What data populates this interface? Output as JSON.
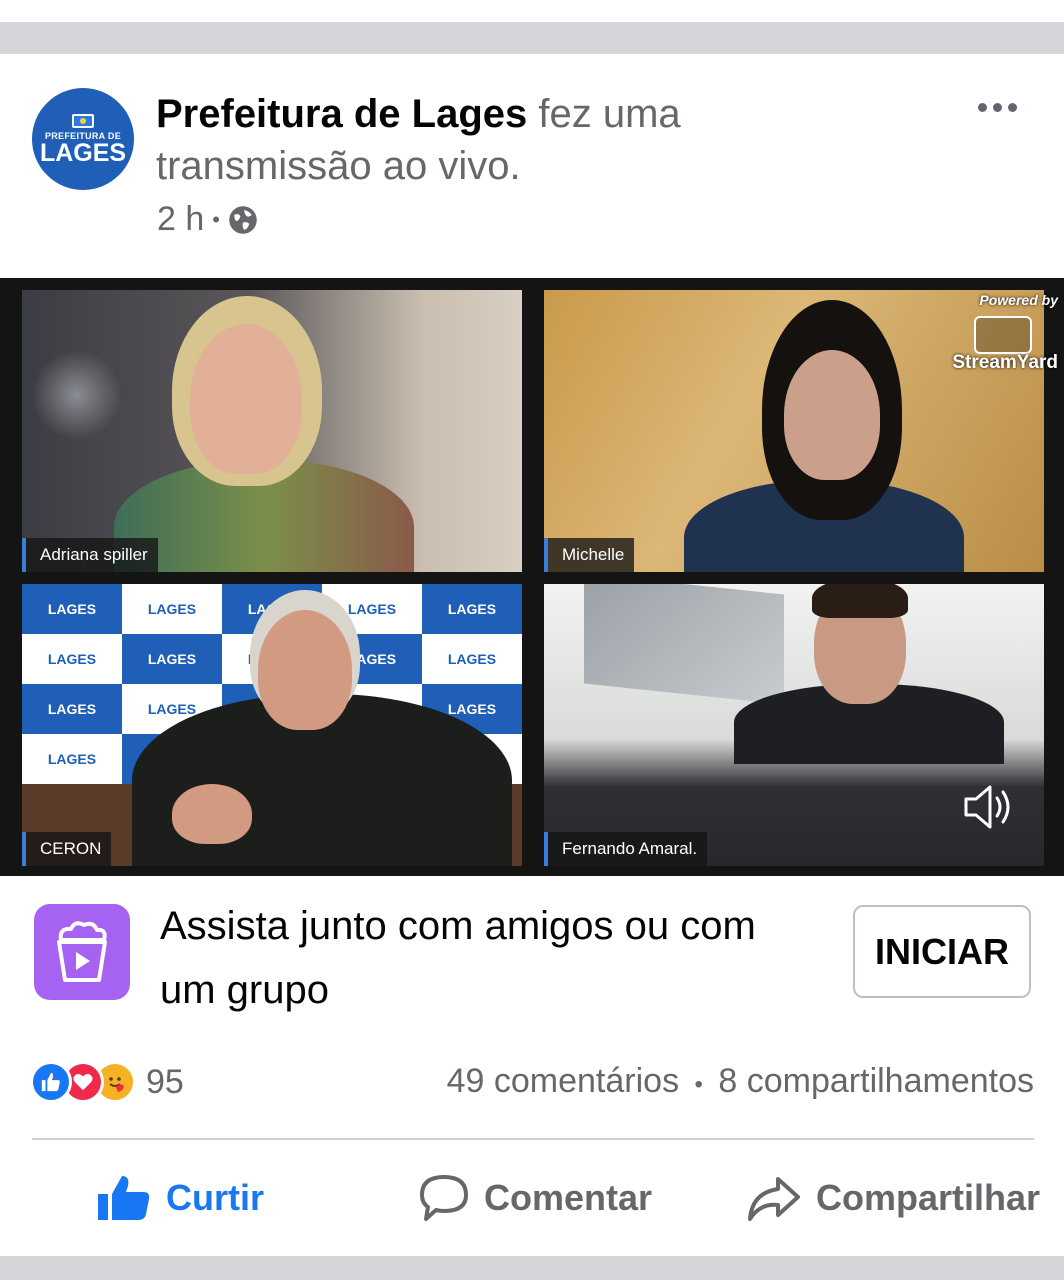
{
  "post": {
    "page_name": "Prefeitura de Lages",
    "action_text": " fez uma transmissão ao vivo.",
    "time": "2 h",
    "separator": "•",
    "privacy_icon": "globe-icon",
    "more_icon": "more-options-icon",
    "avatar": {
      "small_text": "PREFEITURA DE",
      "big_text": "LAGES"
    }
  },
  "video": {
    "participants": [
      {
        "name": "Adriana spiller"
      },
      {
        "name": "Michelle"
      },
      {
        "name": "CERON"
      },
      {
        "name": "Fernando Amaral."
      }
    ],
    "powered_by": "Powered by",
    "provider": "StreamYard",
    "backdrop_logo_text": "LAGES",
    "audio_icon": "speaker-icon"
  },
  "watch_party": {
    "text": "Assista junto com amigos ou com um grupo",
    "button_label": "INICIAR",
    "icon": "watch-party-icon",
    "icon_color": "#a663f1"
  },
  "engagement": {
    "reaction_count": "95",
    "comments": "49 comentários",
    "dot": "•",
    "shares": "8 compartilhamentos"
  },
  "actions": {
    "like": "Curtir",
    "comment": "Comentar",
    "share": "Compartilhar"
  },
  "colors": {
    "accent": "#1877f2",
    "secondary_text": "#65676b",
    "love": "#f0284a",
    "care": "#f7b125"
  }
}
